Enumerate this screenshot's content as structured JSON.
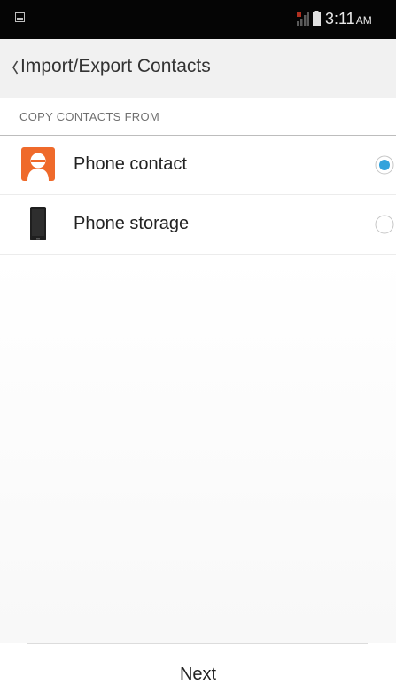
{
  "status_bar": {
    "time": "3:11",
    "ampm": "AM",
    "left_icon": "screenshot-notification-icon",
    "signal_icon": "signal-icon",
    "battery_icon": "battery-icon"
  },
  "action_bar": {
    "back_icon": "chevron-left-icon",
    "title": "Import/Export Contacts"
  },
  "section": {
    "header": "COPY CONTACTS FROM"
  },
  "options": [
    {
      "label": "Phone contact",
      "icon": "contact-avatar-icon",
      "selected": true
    },
    {
      "label": "Phone storage",
      "icon": "phone-device-icon",
      "selected": false
    }
  ],
  "footer": {
    "next_label": "Next"
  },
  "colors": {
    "accent": "#33a3dc",
    "contact_icon": "#ef6a2b",
    "status_bar": "#050505"
  }
}
